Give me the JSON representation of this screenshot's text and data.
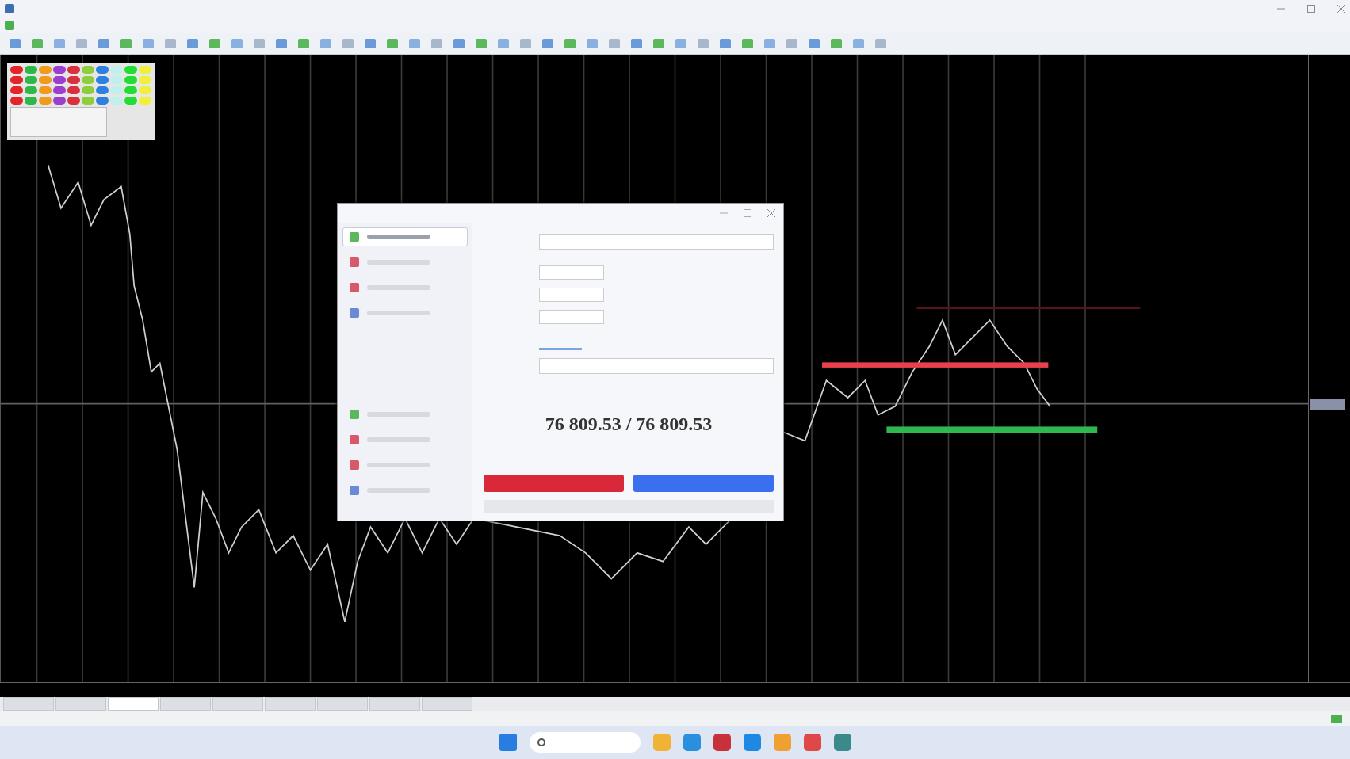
{
  "palette": [
    {
      "color": "#e5232b"
    },
    {
      "color": "#2eb84a"
    },
    {
      "color": "#f29a1c"
    },
    {
      "color": "#9b3fd0"
    },
    {
      "color": "#d8303c"
    },
    {
      "color": "#8ccf3a"
    },
    {
      "color": "#2f7fe0"
    },
    {
      "color": "#bff0ec"
    },
    {
      "color": "#22dd33"
    },
    {
      "color": "#f0f03a"
    }
  ],
  "chart": {
    "levels": [
      {
        "kind": "upper",
        "color": "#5a1418"
      },
      {
        "kind": "middle",
        "color": "#e8404c"
      },
      {
        "kind": "lower",
        "color": "#2fb84f"
      }
    ]
  },
  "order_dialog": {
    "sidebar": [
      {
        "selected": true
      },
      {
        "selected": false
      },
      {
        "selected": false
      },
      {
        "selected": false
      },
      {
        "selected": false
      },
      {
        "selected": false
      },
      {
        "selected": false
      },
      {
        "selected": false
      }
    ],
    "price": "76 809.53 / 76 809.53",
    "actions": [
      {
        "color": "#d9283a"
      },
      {
        "color": "#3a6ff0"
      }
    ]
  },
  "bottom_tabs": [
    {
      "selected": false
    },
    {
      "selected": false
    },
    {
      "selected": true
    },
    {
      "selected": false
    },
    {
      "selected": false
    },
    {
      "selected": false
    },
    {
      "selected": false
    },
    {
      "selected": false
    },
    {
      "selected": false
    }
  ]
}
